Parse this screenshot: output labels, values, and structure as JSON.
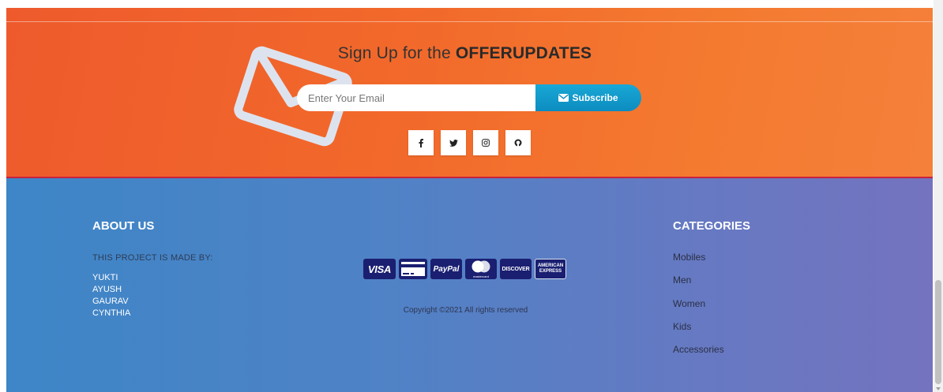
{
  "newsletter": {
    "title_prefix": "Sign Up for the",
    "title_strong": "OFFERUPDATES",
    "email_placeholder": "Enter Your Email",
    "subscribe_label": "Subscribe"
  },
  "social": [
    {
      "icon": "facebook-icon"
    },
    {
      "icon": "twitter-icon"
    },
    {
      "icon": "instagram-icon"
    },
    {
      "icon": "github-icon"
    }
  ],
  "about": {
    "title": "ABOUT US",
    "subtitle": "THIS PROJECT IS MADE BY:",
    "names": [
      "YUKTI",
      "AYUSH",
      "GAURAV",
      "CYNTHIA"
    ]
  },
  "payment": {
    "cards": [
      {
        "label": "VISA",
        "color": "#1a1f71"
      },
      {
        "label": "",
        "color": "#1a1f71"
      },
      {
        "label": "PayPal",
        "color": "#1a1f71"
      },
      {
        "label": "mastercard",
        "color": "#1a1f71"
      },
      {
        "label": "DISCOVER",
        "color": "#1a1f71"
      },
      {
        "label": "AMERICAN EXPRESS",
        "color": "#1a1f71"
      }
    ]
  },
  "copyright": "Copyright ©2021 All rights reserved",
  "categories": {
    "title": "CATEGORIES",
    "items": [
      "Mobiles",
      "Men",
      "Women",
      "Kids",
      "Accessories"
    ]
  },
  "colors": {
    "orange_band": "#f26a2b",
    "divider": "#c7223f",
    "blue_band": "#4f82c6",
    "subscribe": "#0c8cc0",
    "card_navy": "#1a1f71"
  }
}
